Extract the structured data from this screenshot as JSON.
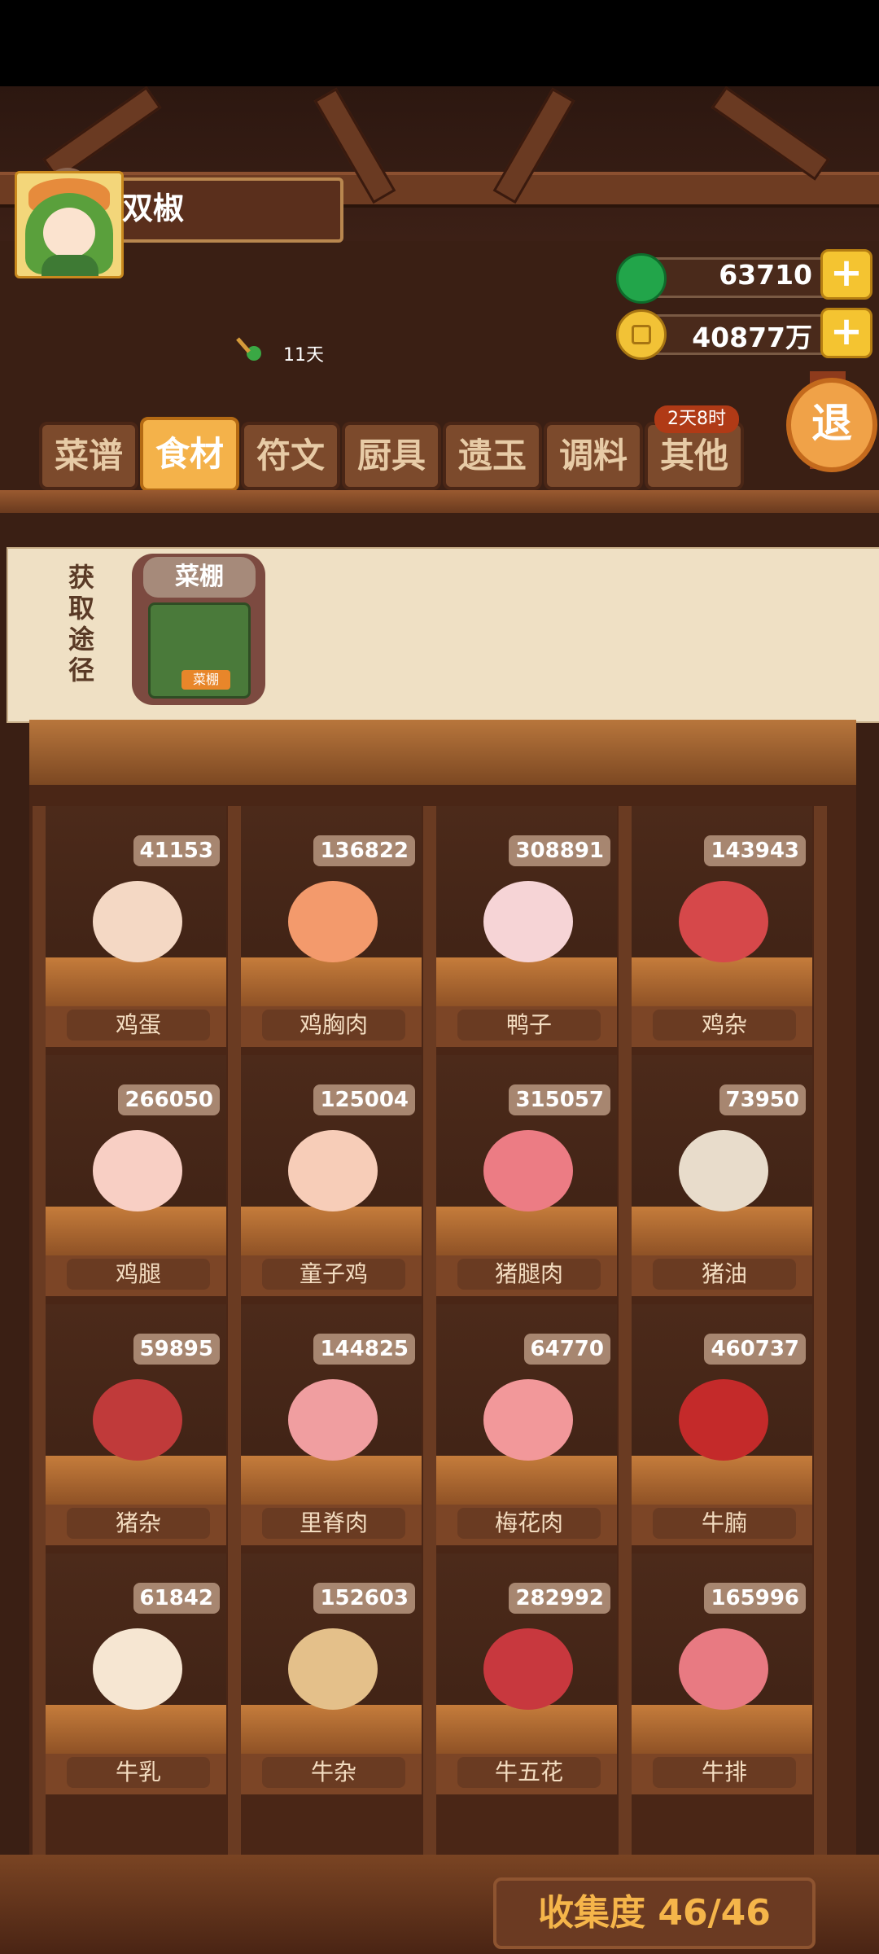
{
  "player": {
    "name": "双椒",
    "days": "11天"
  },
  "currencies": {
    "jade": "63710",
    "coins": "40877万"
  },
  "tabs": [
    {
      "label": "菜谱",
      "active": false
    },
    {
      "label": "食材",
      "active": true
    },
    {
      "label": "符文",
      "active": false
    },
    {
      "label": "厨具",
      "active": false
    },
    {
      "label": "遗玉",
      "active": false
    },
    {
      "label": "调料",
      "active": false
    },
    {
      "label": "其他",
      "active": false
    }
  ],
  "tab_badge": "2天8时",
  "exit_label": "退",
  "source": {
    "title": "获取途径",
    "item_label": "菜棚",
    "item_sign": "菜棚"
  },
  "ingredients": [
    {
      "name": "鸡蛋",
      "count": "41153",
      "color": "#f4d8c4"
    },
    {
      "name": "鸡胸肉",
      "count": "136822",
      "color": "#f39a6c"
    },
    {
      "name": "鸭子",
      "count": "308891",
      "color": "#f6d4d6"
    },
    {
      "name": "鸡杂",
      "count": "143943",
      "color": "#d6484a"
    },
    {
      "name": "鸡腿",
      "count": "266050",
      "color": "#f8cfc4"
    },
    {
      "name": "童子鸡",
      "count": "125004",
      "color": "#f7cdb8"
    },
    {
      "name": "猪腿肉",
      "count": "315057",
      "color": "#ec7c84"
    },
    {
      "name": "猪油",
      "count": "73950",
      "color": "#e8dccb"
    },
    {
      "name": "猪杂",
      "count": "59895",
      "color": "#c03a3a"
    },
    {
      "name": "里脊肉",
      "count": "144825",
      "color": "#f09ea0"
    },
    {
      "name": "梅花肉",
      "count": "64770",
      "color": "#f2989a"
    },
    {
      "name": "牛腩",
      "count": "460737",
      "color": "#c42a2a"
    },
    {
      "name": "牛乳",
      "count": "61842",
      "color": "#f6e6d2"
    },
    {
      "name": "牛杂",
      "count": "152603",
      "color": "#e4c08a"
    },
    {
      "name": "牛五花",
      "count": "282992",
      "color": "#c8383e"
    },
    {
      "name": "牛排",
      "count": "165996",
      "color": "#e87a82"
    }
  ],
  "collection": "收集度 46/46"
}
